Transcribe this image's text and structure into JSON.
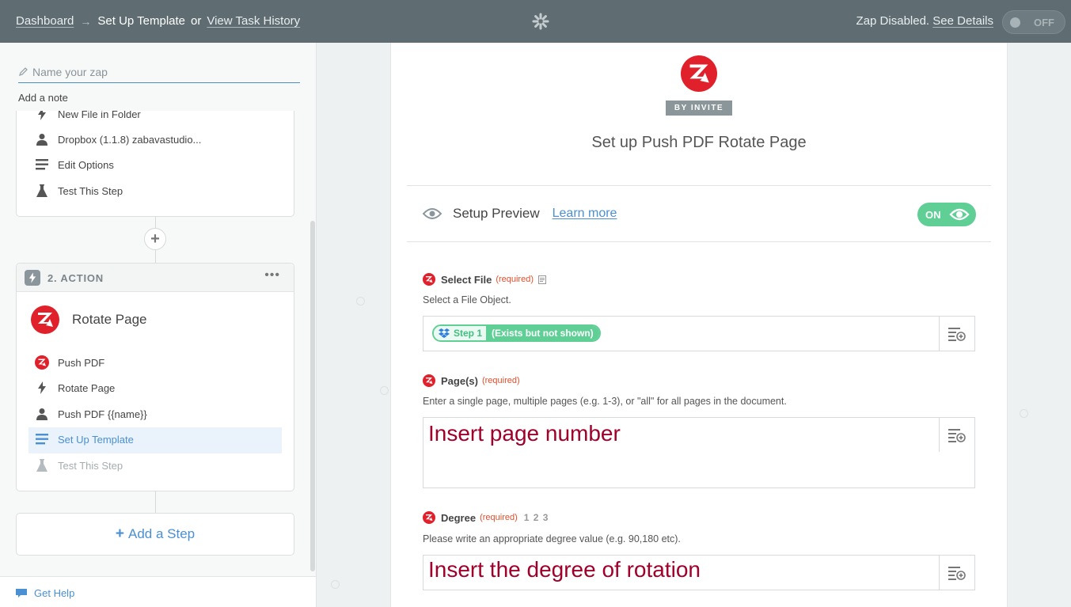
{
  "topbar": {
    "dashboard_link": "Dashboard",
    "current_page": "Set Up Template",
    "or_text": "or",
    "task_history_link": "View Task History",
    "status_text": "Zap Disabled.",
    "see_details_link": "See Details",
    "toggle_label": "OFF"
  },
  "sidebar": {
    "name_placeholder": "Name your zap",
    "add_note": "Add a note",
    "trigger_items": [
      {
        "label": "New File in Folder",
        "icon": "bolt-icon"
      },
      {
        "label": "Dropbox (1.1.8) zabavastudio...",
        "icon": "user-icon"
      },
      {
        "label": "Edit Options",
        "icon": "lines-icon"
      },
      {
        "label": "Test This Step",
        "icon": "flask-icon"
      }
    ],
    "action": {
      "header": "2. ACTION",
      "menu": "•••",
      "app_name": "Rotate Page",
      "items": [
        {
          "label": "Push PDF",
          "icon": "pushpdf-icon"
        },
        {
          "label": "Rotate Page",
          "icon": "bolt-icon"
        },
        {
          "label": "Push PDF {{name}}",
          "icon": "user-icon"
        },
        {
          "label": "Set Up Template",
          "icon": "lines-icon",
          "selected": true
        },
        {
          "label": "Test This Step",
          "icon": "flask-icon",
          "disabled": true
        }
      ]
    },
    "add_step": "Add a Step",
    "add_step_plus": "+",
    "get_help": "Get Help"
  },
  "panel": {
    "badge": "BY INVITE",
    "title": "Set up Push PDF Rotate Page",
    "preview_label": "Setup Preview",
    "learn_more": "Learn more",
    "preview_toggle": "ON",
    "fields": [
      {
        "name": "Select File",
        "required": "(required)",
        "help": "Select a File Object.",
        "pill_step": "Step 1",
        "pill_note": "(Exists but not shown)"
      },
      {
        "name": "Page(s)",
        "required": "(required)",
        "help": "Enter a single page, multiple pages (e.g. 1-3), or \"all\" for all pages in the document.",
        "overlay": "Insert page number"
      },
      {
        "name": "Degree",
        "required": "(required)",
        "extra": "1 2 3",
        "help": "Please write an appropriate degree value (e.g. 90,180 etc).",
        "overlay": "Insert the degree of rotation"
      }
    ]
  },
  "colors": {
    "topbar": "#5f6c72",
    "accent_blue": "#4a90d2",
    "on_green": "#5fcf95",
    "required_red": "#e04e2b",
    "overlay_text": "#a0002a",
    "brand_red": "#e0202a"
  }
}
